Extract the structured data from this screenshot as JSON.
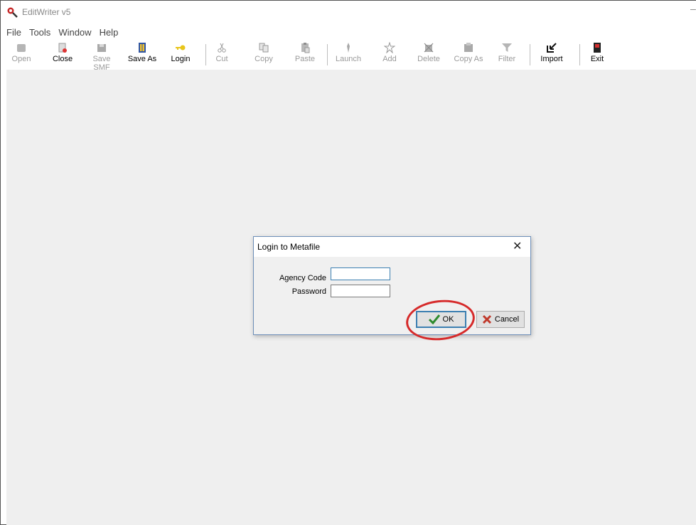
{
  "window": {
    "title": "EditWriter v5",
    "minimize_glyph": "–"
  },
  "menu": [
    "File",
    "Tools",
    "Window",
    "Help"
  ],
  "toolbar": {
    "open": "Open",
    "close": "Close",
    "save_smf": "Save SMF",
    "save_as": "Save As",
    "login": "Login",
    "cut": "Cut",
    "copy": "Copy",
    "paste": "Paste",
    "launch": "Launch",
    "add": "Add",
    "delete": "Delete",
    "copy_as": "Copy As",
    "filter": "Filter",
    "import": "Import",
    "exit": "Exit"
  },
  "dialog": {
    "title": "Login to Metafile",
    "close_glyph": "✕",
    "agency_code_label": "Agency Code",
    "agency_code_value": "",
    "password_label": "Password",
    "password_value": "",
    "ok_label": "OK",
    "cancel_label": "Cancel"
  },
  "colors": {
    "accent_focus": "#3c7fb1",
    "highlight_ring": "#d62a2a",
    "ok_check": "#2e8b2e",
    "cancel_x": "#c0392b"
  }
}
